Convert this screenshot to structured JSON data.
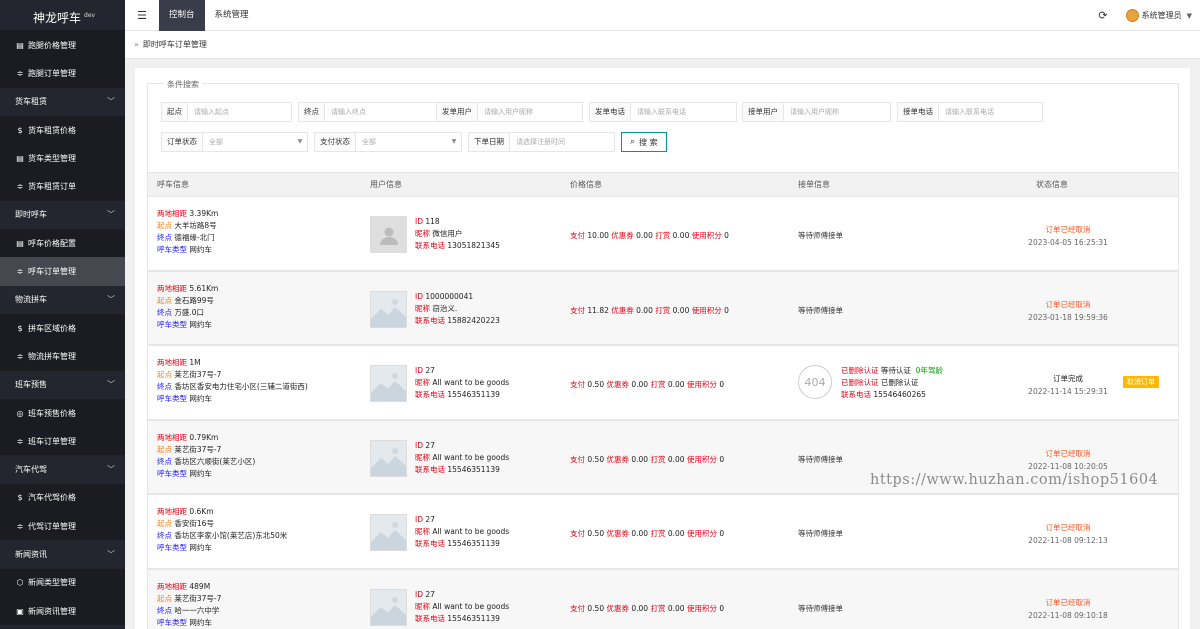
{
  "app": {
    "title": "神龙呼车",
    "badge": "dev"
  },
  "sidebar": {
    "items": [
      {
        "type": "sub",
        "icon": "doc-icon",
        "glyph": "▤",
        "label": "跑腿价格管理"
      },
      {
        "type": "sub",
        "icon": "sliders-icon",
        "glyph": "≑",
        "label": "跑腿订单管理"
      },
      {
        "type": "section",
        "label": "货车租赁"
      },
      {
        "type": "sub",
        "icon": "dollar-icon",
        "glyph": "$",
        "label": "货车租赁价格"
      },
      {
        "type": "sub",
        "icon": "doc-icon",
        "glyph": "▤",
        "label": "货车类型管理"
      },
      {
        "type": "sub",
        "icon": "sliders-icon",
        "glyph": "≑",
        "label": "货车租赁订单"
      },
      {
        "type": "section",
        "label": "即时呼车"
      },
      {
        "type": "sub",
        "icon": "doc-icon",
        "glyph": "▤",
        "label": "呼车价格配置"
      },
      {
        "type": "sub",
        "icon": "sliders-icon",
        "glyph": "≑",
        "label": "呼车订单管理",
        "active": true
      },
      {
        "type": "section",
        "label": "物流拼车"
      },
      {
        "type": "sub",
        "icon": "dollar-icon",
        "glyph": "$",
        "label": "拼车区域价格"
      },
      {
        "type": "sub",
        "icon": "sliders-icon",
        "glyph": "≑",
        "label": "物流拼车管理"
      },
      {
        "type": "section",
        "label": "班车预售"
      },
      {
        "type": "sub",
        "icon": "compass-icon",
        "glyph": "◎",
        "label": "班车预售价格"
      },
      {
        "type": "sub",
        "icon": "sliders-icon",
        "glyph": "≑",
        "label": "班车订单管理"
      },
      {
        "type": "section",
        "label": "汽车代驾"
      },
      {
        "type": "sub",
        "icon": "dollar-icon",
        "glyph": "$",
        "label": "汽车代驾价格"
      },
      {
        "type": "sub",
        "icon": "sliders-icon",
        "glyph": "≑",
        "label": "代驾订单管理"
      },
      {
        "type": "section",
        "label": "新闻资讯"
      },
      {
        "type": "sub",
        "icon": "cube-icon",
        "glyph": "⬡",
        "label": "新闻类型管理"
      },
      {
        "type": "sub",
        "icon": "list-icon",
        "glyph": "▣",
        "label": "新闻资讯管理"
      }
    ]
  },
  "topbar": {
    "tabs": [
      {
        "label": "控制台",
        "active": true
      },
      {
        "label": "系统管理"
      }
    ],
    "user": "系统管理员"
  },
  "breadcrumb": "即时呼车订单管理",
  "search": {
    "legend": "条件搜索",
    "fields": [
      {
        "label": "起点",
        "placeholder": "请输入起点"
      },
      {
        "label": "终点",
        "placeholder": "请输入终点"
      },
      {
        "label": "发单用户",
        "placeholder": "请输入用户昵称"
      },
      {
        "label": "发单电话",
        "placeholder": "请输入联系电话"
      },
      {
        "label": "接单用户",
        "placeholder": "请输入用户昵称"
      },
      {
        "label": "接单电话",
        "placeholder": "请输入联系电话"
      }
    ],
    "selects": [
      {
        "label": "订单状态",
        "value": "全部"
      },
      {
        "label": "支付状态",
        "value": "全部"
      }
    ],
    "date": {
      "label": "下单日期",
      "placeholder": "请选择注册时间"
    },
    "button": "搜 索"
  },
  "table": {
    "headers": [
      "呼车信息",
      "用户信息",
      "价格信息",
      "接单信息",
      "状态信息"
    ],
    "labels": {
      "distance": "两地相距",
      "start": "起点",
      "end": "终点",
      "type": "呼车类型",
      "id": "ID",
      "nick": "昵称",
      "phone": "联系电话",
      "pay": "支付",
      "coupon": "优惠券",
      "tip": "打赏",
      "points": "使用积分"
    },
    "rows": [
      {
        "distance": "3.39Km",
        "start": "大羊坊路8号",
        "end": "德福缘-北门",
        "type": "网约车",
        "avatar": "person",
        "id": "118",
        "nick": "微信用户",
        "phone": "13051821345",
        "pay": "10.00",
        "coupon": "0.00",
        "tip": "0.00",
        "points": "0",
        "driver": "等待师傅接单",
        "status": "订单已经取消",
        "status_type": "cancel",
        "time": "2023-04-05 16:25:31"
      },
      {
        "distance": "5.61Km",
        "start": "金石路99号",
        "end": "万盛.0口",
        "type": "网约车",
        "avatar": "land",
        "id": "1000000041",
        "nick": "窃治义.",
        "phone": "15882420223",
        "pay": "11.82",
        "coupon": "0.00",
        "tip": "0.00",
        "points": "0",
        "driver": "等待师傅接单",
        "status": "订单已经取消",
        "status_type": "cancel",
        "time": "2023-01-18 19:59:36"
      },
      {
        "distance": "1M",
        "start": "莱艺街37号-7",
        "end": "香坊区香安电力住宅小区(三辅二道街西)",
        "type": "网约车",
        "avatar": "land",
        "id": "27",
        "nick": "All want to be goods",
        "phone": "15546351139",
        "pay": "0.50",
        "coupon": "0.00",
        "tip": "0.00",
        "points": "0",
        "driver": null,
        "driver_info": {
          "avatar_text": "404",
          "line1_a": "已删除认证",
          "line1_b": "等待认证",
          "line1_c": "0年驾龄",
          "line2_a": "已删除认证",
          "line2_b": "已删除认证",
          "line3_a": "联系电话",
          "line3_b": "15546460265"
        },
        "status": "订单完成",
        "status_type": "done",
        "time": "2022-11-14 15:29:31",
        "action": "取消订单"
      },
      {
        "distance": "0.79Km",
        "start": "莱艺街37号-7",
        "end": "香坊区六顺街(莱艺小区)",
        "type": "网约车",
        "avatar": "land",
        "id": "27",
        "nick": "All want to be goods",
        "phone": "15546351139",
        "pay": "0.50",
        "coupon": "0.00",
        "tip": "0.00",
        "points": "0",
        "driver": "等待师傅接单",
        "status": "订单已经取消",
        "status_type": "cancel",
        "time": "2022-11-08 10:20:05"
      },
      {
        "distance": "0.6Km",
        "start": "香安街16号",
        "end": "香坊区李家小馆(莱艺店)东北50米",
        "type": "网约车",
        "avatar": "land",
        "id": "27",
        "nick": "All want to be goods",
        "phone": "15546351139",
        "pay": "0.50",
        "coupon": "0.00",
        "tip": "0.00",
        "points": "0",
        "driver": "等待师傅接单",
        "status": "订单已经取消",
        "status_type": "cancel",
        "time": "2022-11-08 09:12:13"
      },
      {
        "distance": "489M",
        "start": "莱艺街37号-7",
        "end": "哈一一六中学",
        "type": "网约车",
        "avatar": "land",
        "id": "27",
        "nick": "All want to be goods",
        "phone": "15546351139",
        "pay": "0.50",
        "coupon": "0.00",
        "tip": "0.00",
        "points": "0",
        "driver": "等待师傅接单",
        "status": "订单已经取消",
        "status_type": "cancel",
        "time": "2022-11-08 09:10:18"
      }
    ]
  },
  "watermark": "https://www.huzhan.com/ishop51604"
}
